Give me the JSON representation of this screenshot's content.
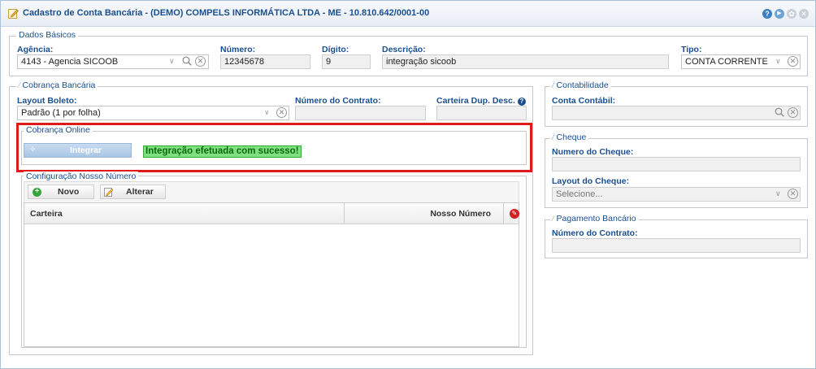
{
  "window": {
    "title": "Cadastro de Conta Bancária - (DEMO) COMPELS INFORMÁTICA LTDA - ME - 10.810.642/0001-00",
    "help_icon": "help-icon",
    "play_icon": "play-icon",
    "settings_icon": "gear-icon",
    "close_icon": "close-icon"
  },
  "dados_basicos": {
    "legend": "Dados Básicos",
    "agencia_label": "Agência:",
    "agencia_value": "4143 - Agencia SICOOB",
    "numero_label": "Número:",
    "numero_value": "12345678",
    "digito_label": "Dígito:",
    "digito_value": "9",
    "descricao_label": "Descrição:",
    "descricao_value": "integração sicoob",
    "tipo_label": "Tipo:",
    "tipo_value": "CONTA CORRENTE"
  },
  "cobranca": {
    "legend": "Cobrança Bancária",
    "layout_label": "Layout Boleto:",
    "layout_value": "Padrão (1 por folha)",
    "contrato_label": "Número do Contrato:",
    "contrato_value": "",
    "carteira_label": "Carteira Dup. Desc.",
    "carteira_value": ""
  },
  "cobranca_online": {
    "legend": "Cobrança Online",
    "integrar_label": "Integrar",
    "status_message": "Integração efetuada com sucesso!"
  },
  "nosso_numero": {
    "legend": "Configuração Nosso Número",
    "novo_label": "Novo",
    "alterar_label": "Alterar",
    "columns": [
      "Carteira",
      "Nosso Número"
    ],
    "rows": []
  },
  "contabilidade": {
    "legend": "Contabilidade",
    "conta_label": "Conta Contábil:",
    "conta_value": ""
  },
  "cheque": {
    "legend": "Cheque",
    "numero_label": "Numero do Cheque:",
    "numero_value": "",
    "layout_label": "Layout do Cheque:",
    "layout_placeholder": "Selecione..."
  },
  "pagamento": {
    "legend": "Pagamento Bancário",
    "contrato_label": "Número do Contrato:",
    "contrato_value": ""
  },
  "colors": {
    "title": "#1a4f8f",
    "success_bg": "#7ee07e",
    "success_text": "#0a6a0a",
    "highlight": "#e01a1a"
  }
}
